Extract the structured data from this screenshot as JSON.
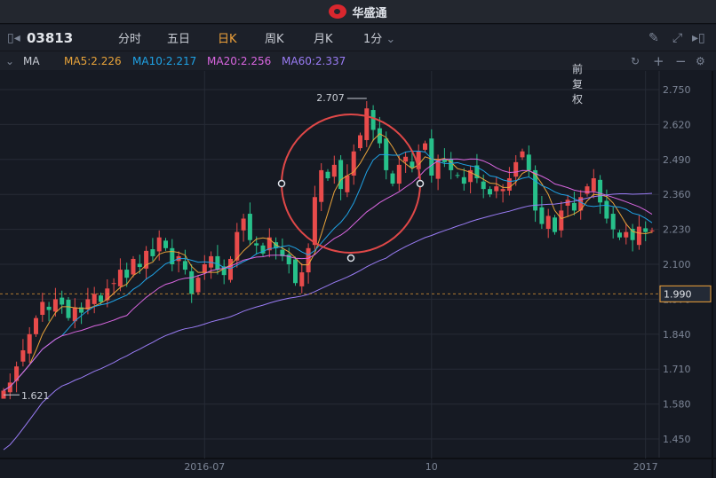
{
  "app": {
    "title": "华盛通"
  },
  "toolbar": {
    "stock_code": "03813",
    "tabs": [
      "分时",
      "五日",
      "日K",
      "周K",
      "月K",
      "1分"
    ],
    "active_tab": "日K"
  },
  "ma_bar": {
    "indicator": "MA",
    "ma5": "MA5:2.226",
    "ma10": "MA10:2.217",
    "ma20": "MA20:2.256",
    "ma60": "MA60:2.337",
    "adjust": "前复权"
  },
  "colors": {
    "up": "#e84b4b",
    "down": "#27c08a",
    "ma5": "#e8a33a",
    "ma10": "#1fa3e6",
    "ma20": "#d966e0",
    "ma60": "#9a7cf5",
    "highlight": "#f0a23a"
  },
  "chart_data": {
    "type": "candlestick",
    "ylim": [
      1.4,
      2.8
    ],
    "y_ticks": [
      "2.750",
      "2.620",
      "2.490",
      "2.360",
      "2.230",
      "2.100",
      "1.970",
      "1.840",
      "1.710",
      "1.580",
      "1.450"
    ],
    "x_ticks": [
      {
        "label": "2016-07",
        "index": 31
      },
      {
        "label": "10",
        "index": 66
      },
      {
        "label": "2017",
        "index": 99
      }
    ],
    "current_price": "1.990",
    "high_label": "2.707",
    "low_label": "1.621",
    "closes": [
      1.63,
      1.66,
      1.72,
      1.78,
      1.84,
      1.9,
      1.96,
      1.93,
      1.97,
      1.95,
      1.9,
      1.94,
      1.92,
      1.97,
      1.99,
      1.96,
      2.01,
      2.03,
      2.08,
      2.05,
      2.12,
      2.09,
      2.15,
      2.13,
      2.2,
      2.16,
      2.1,
      2.13,
      2.08,
      1.99,
      2.05,
      2.1,
      2.13,
      2.08,
      2.06,
      2.12,
      2.22,
      2.27,
      2.19,
      2.17,
      2.14,
      2.2,
      2.16,
      2.13,
      2.1,
      2.03,
      2.07,
      2.16,
      2.35,
      2.45,
      2.42,
      2.47,
      2.38,
      2.43,
      2.52,
      2.58,
      2.68,
      2.6,
      2.55,
      2.45,
      2.4,
      2.47,
      2.5,
      2.46,
      2.52,
      2.55,
      2.43,
      2.49,
      2.48,
      2.45,
      2.43,
      2.4,
      2.45,
      2.42,
      2.38,
      2.36,
      2.39,
      2.38,
      2.42,
      2.48,
      2.52,
      2.45,
      2.3,
      2.25,
      2.28,
      2.22,
      2.3,
      2.34,
      2.3,
      2.35,
      2.39,
      2.42,
      2.33,
      2.27,
      2.23,
      2.2,
      2.22,
      2.19,
      2.24,
      2.22,
      2.226
    ]
  }
}
